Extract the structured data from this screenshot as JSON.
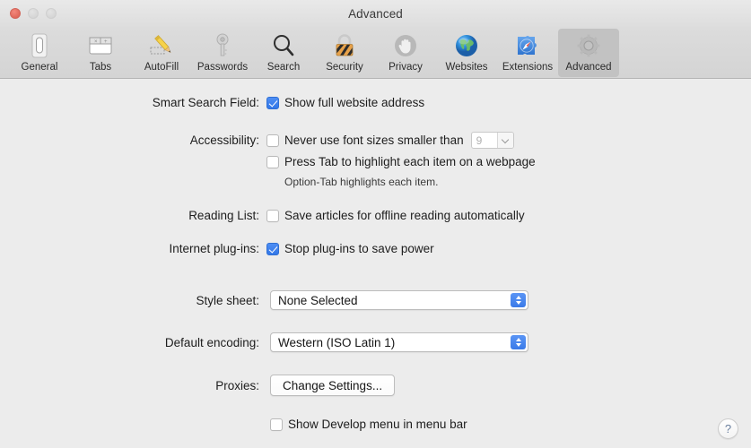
{
  "window": {
    "title": "Advanced",
    "controls": {
      "close": "close-button",
      "minimize": "minimize-button",
      "zoom": "zoom-button"
    }
  },
  "toolbar": {
    "items": [
      {
        "label": "General",
        "icon": "general-icon",
        "selected": false
      },
      {
        "label": "Tabs",
        "icon": "tabs-icon",
        "selected": false
      },
      {
        "label": "AutoFill",
        "icon": "autofill-icon",
        "selected": false
      },
      {
        "label": "Passwords",
        "icon": "passwords-icon",
        "selected": false
      },
      {
        "label": "Search",
        "icon": "search-icon",
        "selected": false
      },
      {
        "label": "Security",
        "icon": "security-icon",
        "selected": false
      },
      {
        "label": "Privacy",
        "icon": "privacy-icon",
        "selected": false
      },
      {
        "label": "Websites",
        "icon": "websites-icon",
        "selected": false
      },
      {
        "label": "Extensions",
        "icon": "extensions-icon",
        "selected": false
      },
      {
        "label": "Advanced",
        "icon": "advanced-icon",
        "selected": true
      }
    ]
  },
  "main": {
    "smart_search": {
      "label": "Smart Search Field:",
      "checkbox_label": "Show full website address",
      "checked": true
    },
    "accessibility": {
      "label": "Accessibility:",
      "font_size_label": "Never use font sizes smaller than",
      "font_size_checked": false,
      "font_size_value": "9",
      "tab_highlight_label": "Press Tab to highlight each item on a webpage",
      "tab_highlight_checked": false,
      "hint": "Option-Tab highlights each item."
    },
    "reading_list": {
      "label": "Reading List:",
      "checkbox_label": "Save articles for offline reading automatically",
      "checked": false
    },
    "plugins": {
      "label": "Internet plug-ins:",
      "checkbox_label": "Stop plug-ins to save power",
      "checked": true
    },
    "style_sheet": {
      "label": "Style sheet:",
      "value": "None Selected"
    },
    "default_encoding": {
      "label": "Default encoding:",
      "value": "Western (ISO Latin 1)"
    },
    "proxies": {
      "label": "Proxies:",
      "button_label": "Change Settings..."
    },
    "develop_menu": {
      "checkbox_label": "Show Develop menu in menu bar",
      "checked": false
    },
    "help_glyph": "?"
  },
  "colors": {
    "accent": "#3a7ae8",
    "background": "#ececec",
    "toolbar": "#d6d6d6",
    "selected_tab": "#c2c2c2"
  }
}
